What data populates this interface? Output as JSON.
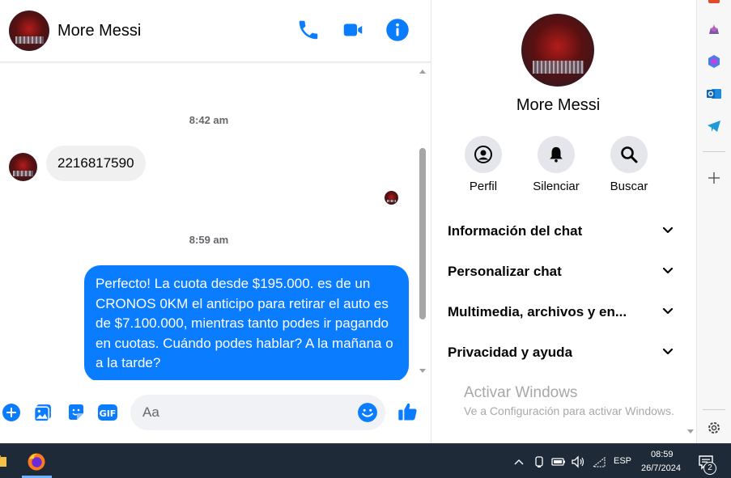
{
  "chat": {
    "contact_name": "More Messi",
    "messages": [
      {
        "time": "8:42 am",
        "text": "2216817590",
        "direction": "incoming"
      },
      {
        "time": "8:59 am",
        "text": "Perfecto! La cuota desde $195.000. es de un CRONOS 0KM el anticipo para retirar el auto es de $7.100.000, mientras tanto podes ir pagando en cuotas. Cuándo podes hablar? A la mañana o a la tarde?",
        "direction": "outgoing"
      }
    ],
    "composer": {
      "placeholder": "Aa"
    },
    "icons": {
      "call": "phone-icon",
      "video": "video-camera-icon",
      "info": "info-icon"
    }
  },
  "profile_panel": {
    "name": "More Messi",
    "actions": [
      {
        "label": "Perfil",
        "icon": "profile-icon"
      },
      {
        "label": "Silenciar",
        "icon": "bell-icon"
      },
      {
        "label": "Buscar",
        "icon": "search-icon"
      }
    ],
    "sections": [
      {
        "label": "Información del chat"
      },
      {
        "label": "Personalizar chat"
      },
      {
        "label": "Multimedia, archivos y en..."
      },
      {
        "label": "Privacidad y ayuda"
      }
    ]
  },
  "watermark": {
    "title": "Activar Windows",
    "subtitle": "Ve a Configuración para activar Windows."
  },
  "taskbar": {
    "language": "ESP",
    "time": "08:59",
    "date": "26/7/2024",
    "notification_count": "2"
  },
  "colors": {
    "accent": "#0a7cff",
    "bubble_in": "#f0f0f0",
    "taskbar": "#1f2a38"
  }
}
